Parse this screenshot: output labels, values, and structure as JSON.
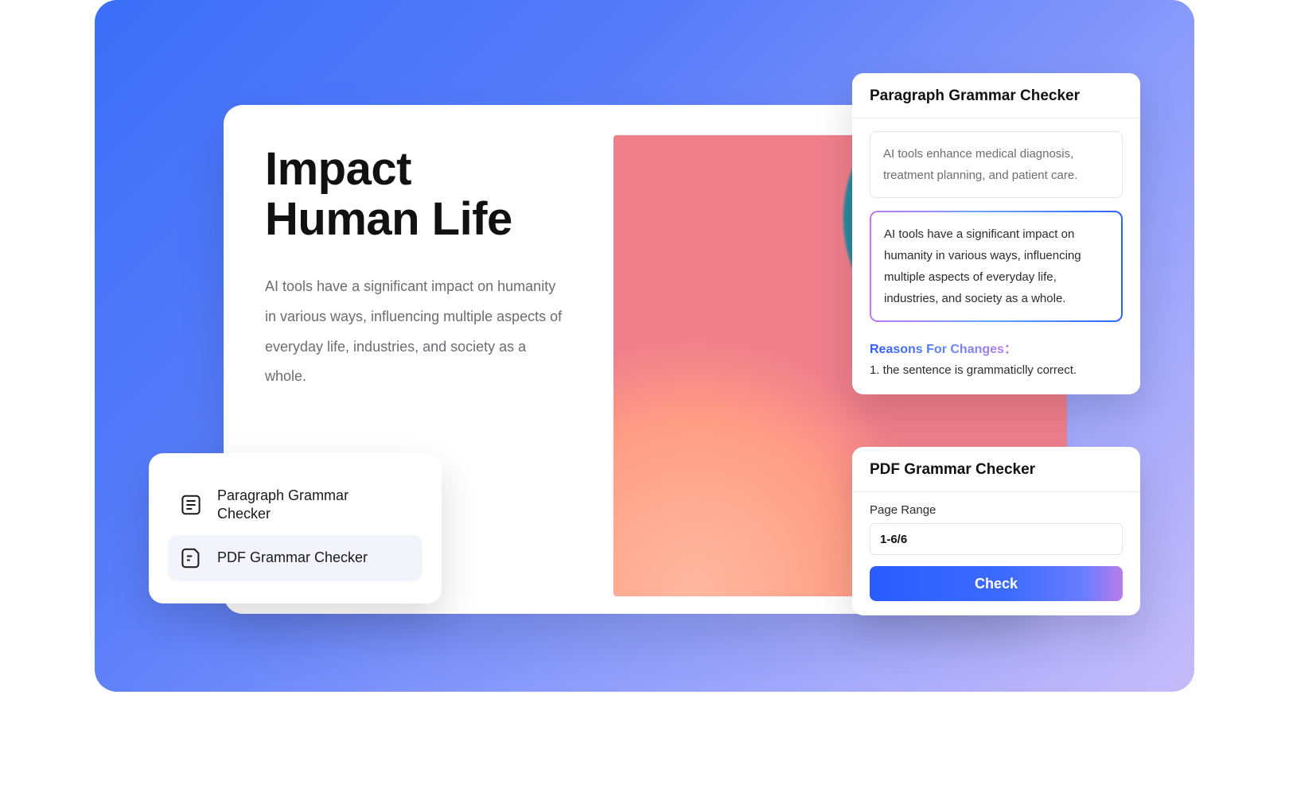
{
  "document": {
    "title_line1": "Impact",
    "title_line2": "Human Life",
    "body": "AI tools have a significant impact on humanity in various ways, influencing multiple aspects of everyday life, industries, and society as a whole."
  },
  "menu": {
    "items": [
      {
        "label": "Paragraph Grammar Checker",
        "active": false
      },
      {
        "label": "PDF Grammar Checker",
        "active": true
      }
    ]
  },
  "paragraph_panel": {
    "title": "Paragraph Grammar Checker",
    "input_text": "AI tools enhance medical diagnosis, treatment planning, and patient care.",
    "output_text": "AI tools have a significant impact on humanity in various ways, influencing multiple aspects of everyday life, industries, and society as a whole.",
    "reasons_label": "Reasons For Changes：",
    "reasons": [
      "1. the sentence is grammaticlly correct."
    ]
  },
  "pdf_panel": {
    "title": "PDF Grammar Checker",
    "range_label": "Page Range",
    "range_value": "1-6/6",
    "check_label": "Check"
  }
}
